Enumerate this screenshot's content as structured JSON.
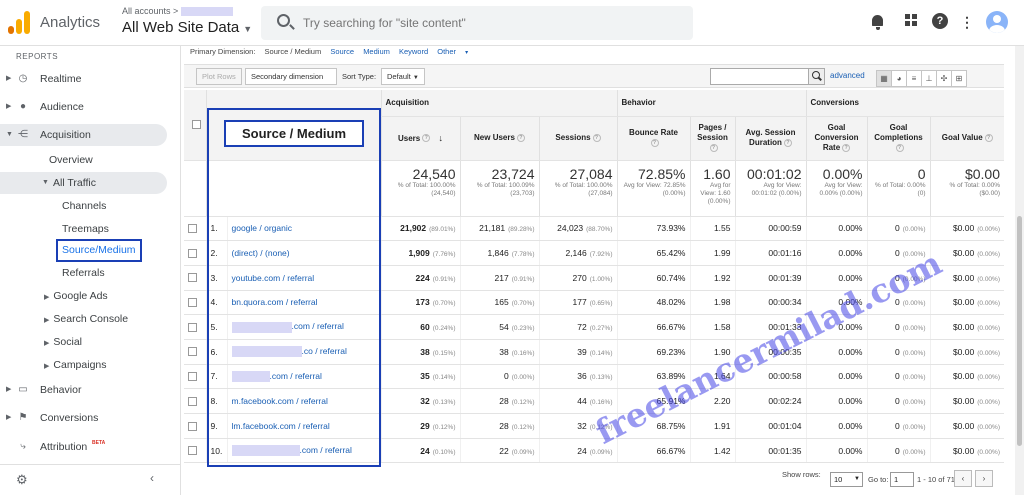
{
  "header": {
    "app_name": "Analytics",
    "account_path": "All accounts >",
    "property": "All Web Site Data",
    "search_placeholder": "Try searching for \"site content\""
  },
  "sidebar": {
    "section": "REPORTS",
    "items": [
      {
        "label": "Realtime",
        "icon": "clock-icon"
      },
      {
        "label": "Audience",
        "icon": "person-icon"
      },
      {
        "label": "Acquisition",
        "icon": "acquisition-icon"
      },
      {
        "label": "Behavior",
        "icon": "behavior-icon"
      },
      {
        "label": "Conversions",
        "icon": "flag-icon"
      },
      {
        "label": "Attribution",
        "icon": "attribution-icon",
        "badge": "BETA"
      }
    ],
    "acq_sub": {
      "overview": "Overview",
      "all_traffic": "All Traffic",
      "channels": "Channels",
      "treemaps": "Treemaps",
      "source_medium": "Source/Medium",
      "referrals": "Referrals",
      "google_ads": "Google Ads",
      "search_console": "Search Console",
      "social": "Social",
      "campaigns": "Campaigns"
    }
  },
  "dimension_bar": {
    "label": "Primary Dimension:",
    "current": "Source / Medium",
    "options": [
      "Source",
      "Medium",
      "Keyword",
      "Other"
    ]
  },
  "toolbar": {
    "plot_rows": "Plot Rows",
    "secondary": "Secondary dimension",
    "sort_label": "Sort Type:",
    "sort_value": "Default",
    "advanced": "advanced"
  },
  "table": {
    "dim_header": "Source / Medium",
    "groups": {
      "acquisition": "Acquisition",
      "behavior": "Behavior",
      "conversions": "Conversions"
    },
    "columns": {
      "users": "Users",
      "new_users": "New Users",
      "sessions": "Sessions",
      "bounce": "Bounce Rate",
      "pages": "Pages / Session",
      "duration": "Avg. Session Duration",
      "conv_rate": "Goal Conversion Rate",
      "completions": "Goal Completions",
      "value": "Goal Value"
    },
    "totals": {
      "users": {
        "v": "24,540",
        "s": "% of Total: 100.00% (24,540)"
      },
      "new_users": {
        "v": "23,724",
        "s": "% of Total: 100.09% (23,703)"
      },
      "sessions": {
        "v": "27,084",
        "s": "% of Total: 100.00% (27,084)"
      },
      "bounce": {
        "v": "72.85%",
        "s": "Avg for View: 72.85% (0.00%)"
      },
      "pages": {
        "v": "1.60",
        "s": "Avg for View: 1.60 (0.00%)"
      },
      "duration": {
        "v": "00:01:02",
        "s": "Avg for View: 00:01:02 (0.00%)"
      },
      "conv_rate": {
        "v": "0.00%",
        "s": "Avg for View: 0.00% (0.00%)"
      },
      "completions": {
        "v": "0",
        "s": "% of Total: 0.00% (0)"
      },
      "value": {
        "v": "$0.00",
        "s": "% of Total: 0.00% ($0.00)"
      }
    },
    "rows": [
      {
        "idx": "1.",
        "src": "google / organic",
        "blur": 0,
        "u": "21,902",
        "up": "(89.01%)",
        "n": "21,181",
        "np": "(89.28%)",
        "s": "24,023",
        "sp": "(88.70%)",
        "b": "73.93%",
        "p": "1.55",
        "d": "00:00:59",
        "c": "0.00%",
        "g": "0",
        "gp": "(0.00%)",
        "v": "$0.00",
        "vp": "(0.00%)"
      },
      {
        "idx": "2.",
        "src": "(direct) / (none)",
        "blur": 0,
        "u": "1,909",
        "up": "(7.76%)",
        "n": "1,846",
        "np": "(7.78%)",
        "s": "2,146",
        "sp": "(7.92%)",
        "b": "65.42%",
        "p": "1.99",
        "d": "00:01:16",
        "c": "0.00%",
        "g": "0",
        "gp": "(0.00%)",
        "v": "$0.00",
        "vp": "(0.00%)"
      },
      {
        "idx": "3.",
        "src": "youtube.com / referral",
        "blur": 0,
        "u": "224",
        "up": "(0.91%)",
        "n": "217",
        "np": "(0.91%)",
        "s": "270",
        "sp": "(1.00%)",
        "b": "60.74%",
        "p": "1.92",
        "d": "00:01:39",
        "c": "0.00%",
        "g": "0",
        "gp": "(0.00%)",
        "v": "$0.00",
        "vp": "(0.00%)"
      },
      {
        "idx": "4.",
        "src": "bn.quora.com / referral",
        "blur": 0,
        "u": "173",
        "up": "(0.70%)",
        "n": "165",
        "np": "(0.70%)",
        "s": "177",
        "sp": "(0.65%)",
        "b": "48.02%",
        "p": "1.98",
        "d": "00:00:34",
        "c": "0.00%",
        "g": "0",
        "gp": "(0.00%)",
        "v": "$0.00",
        "vp": "(0.00%)"
      },
      {
        "idx": "5.",
        "src": ".com / referral",
        "blur": 60,
        "u": "60",
        "up": "(0.24%)",
        "n": "54",
        "np": "(0.23%)",
        "s": "72",
        "sp": "(0.27%)",
        "b": "66.67%",
        "p": "1.58",
        "d": "00:01:33",
        "c": "0.00%",
        "g": "0",
        "gp": "(0.00%)",
        "v": "$0.00",
        "vp": "(0.00%)"
      },
      {
        "idx": "6.",
        "src": ".co / referral",
        "blur": 70,
        "u": "38",
        "up": "(0.15%)",
        "n": "38",
        "np": "(0.16%)",
        "s": "39",
        "sp": "(0.14%)",
        "b": "69.23%",
        "p": "1.90",
        "d": "00:00:35",
        "c": "0.00%",
        "g": "0",
        "gp": "(0.00%)",
        "v": "$0.00",
        "vp": "(0.00%)"
      },
      {
        "idx": "7.",
        "src": ".com / referral",
        "blur": 38,
        "u": "35",
        "up": "(0.14%)",
        "n": "0",
        "np": "(0.00%)",
        "s": "36",
        "sp": "(0.13%)",
        "b": "63.89%",
        "p": "1.64",
        "d": "00:00:58",
        "c": "0.00%",
        "g": "0",
        "gp": "(0.00%)",
        "v": "$0.00",
        "vp": "(0.00%)"
      },
      {
        "idx": "8.",
        "src": "m.facebook.com / referral",
        "blur": 0,
        "u": "32",
        "up": "(0.13%)",
        "n": "28",
        "np": "(0.12%)",
        "s": "44",
        "sp": "(0.16%)",
        "b": "65.91%",
        "p": "2.20",
        "d": "00:02:24",
        "c": "0.00%",
        "g": "0",
        "gp": "(0.00%)",
        "v": "$0.00",
        "vp": "(0.00%)"
      },
      {
        "idx": "9.",
        "src": "lm.facebook.com / referral",
        "blur": 0,
        "u": "29",
        "up": "(0.12%)",
        "n": "28",
        "np": "(0.12%)",
        "s": "32",
        "sp": "(0.12%)",
        "b": "68.75%",
        "p": "1.91",
        "d": "00:01:04",
        "c": "0.00%",
        "g": "0",
        "gp": "(0.00%)",
        "v": "$0.00",
        "vp": "(0.00%)"
      },
      {
        "idx": "10.",
        "src": ".com / referral",
        "blur": 68,
        "u": "24",
        "up": "(0.10%)",
        "n": "22",
        "np": "(0.09%)",
        "s": "24",
        "sp": "(0.09%)",
        "b": "66.67%",
        "p": "1.42",
        "d": "00:01:35",
        "c": "0.00%",
        "g": "0",
        "gp": "(0.00%)",
        "v": "$0.00",
        "vp": "(0.00%)"
      }
    ]
  },
  "pagination": {
    "show_rows_label": "Show rows:",
    "show_rows_value": "10",
    "goto_label": "Go to:",
    "goto_value": "1",
    "range": "1 - 10 of 71"
  },
  "watermark": "freelancermilad.com",
  "colors": {
    "accent": "#1a3fb5",
    "link": "#1a5fb4",
    "logo_orange": "#f9ab00",
    "logo_dark": "#e37400"
  }
}
